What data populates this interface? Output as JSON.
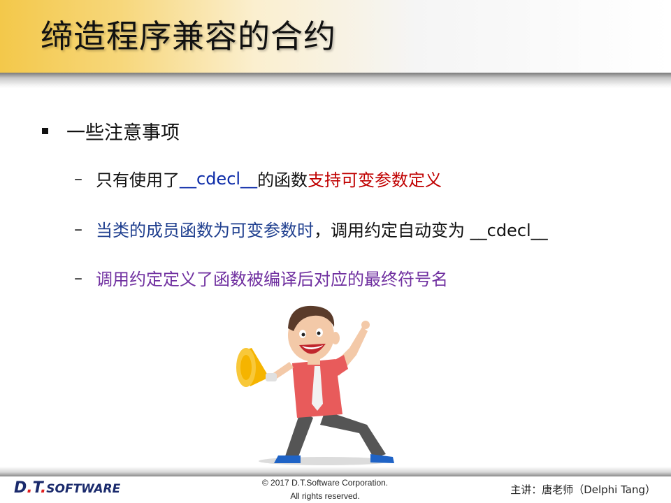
{
  "title": "缔造程序兼容的合约",
  "bullet": "一些注意事项",
  "items": [
    {
      "parts": [
        "只有使用了 ",
        "__cdecl__",
        " 的函数",
        "支持可变参数定义"
      ]
    },
    {
      "parts": [
        "当类的成员函数为可变参数时",
        "，调用约定自动变为 __cdecl__"
      ]
    },
    {
      "parts": [
        "调用约定定义了函数被编译后对应的最终符号名"
      ]
    }
  ],
  "footer": {
    "logo_a": "D",
    "logo_dot": ".",
    "logo_b": "T",
    "logo_c": "SOFTWARE",
    "copyright_line1": "© 2017 D.T.Software Corporation.",
    "copyright_line2": "All rights reserved.",
    "presenter": "主讲：唐老师（Delphi Tang）"
  },
  "colors": {
    "blue": "#0b2aa8",
    "red": "#c00000",
    "navy": "#1f3f8f",
    "purple": "#7030a0",
    "title_band": "#f3c84a"
  }
}
